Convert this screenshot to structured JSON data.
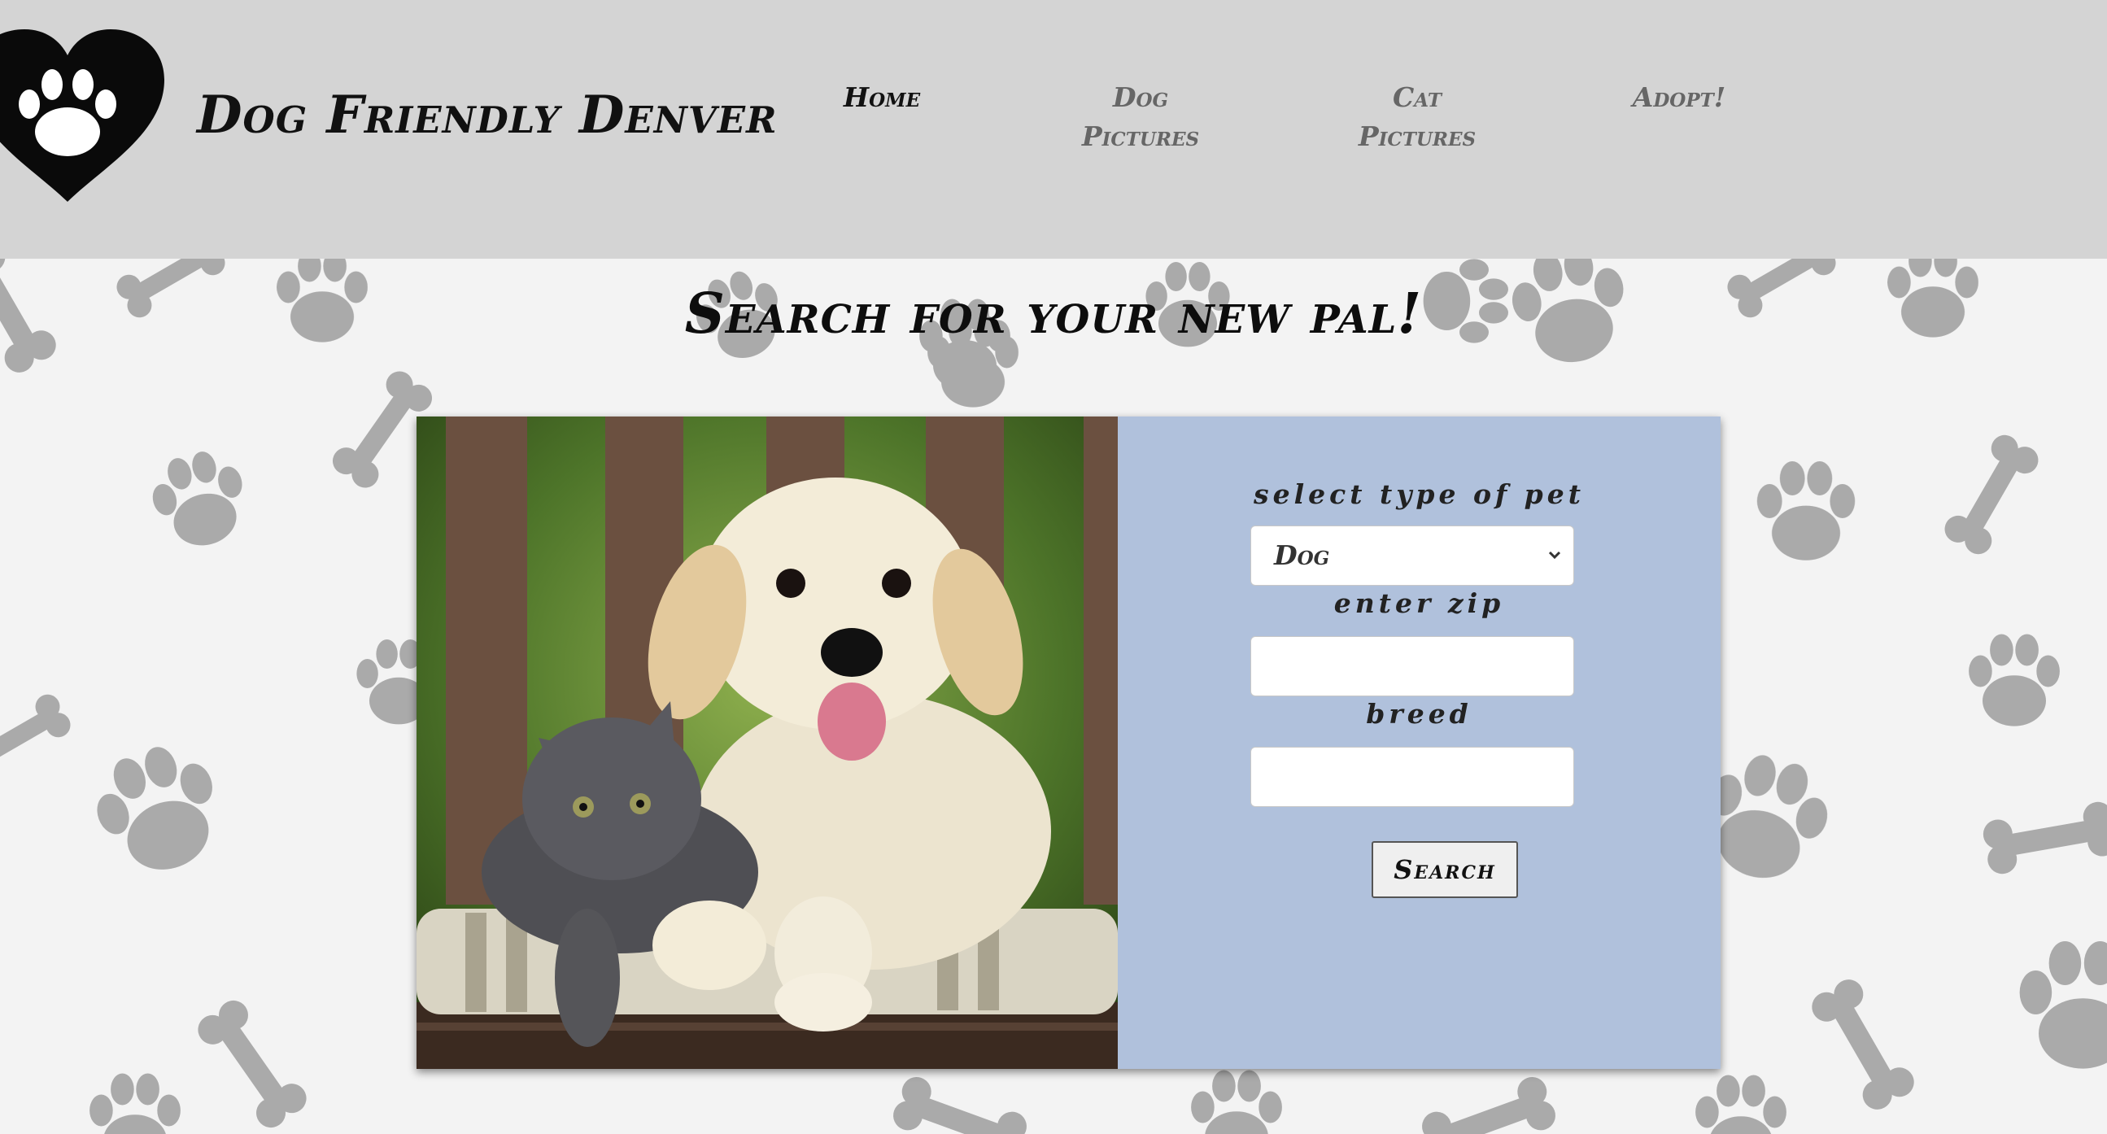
{
  "header": {
    "site_title": "Dog Friendly Denver",
    "nav": [
      {
        "line1": "Home",
        "line2": ""
      },
      {
        "line1": "Dog",
        "line2": "Pictures"
      },
      {
        "line1": "Cat",
        "line2": "Pictures"
      },
      {
        "line1": "Adopt!",
        "line2": ""
      }
    ]
  },
  "main": {
    "heading": "Search for your new pal!"
  },
  "form": {
    "pet_type_label": "select type of pet",
    "pet_type_value": "Dog",
    "zip_label": "enter zip",
    "zip_value": "",
    "breed_label": "breed",
    "breed_value": "",
    "search_label": "Search"
  },
  "icons": {
    "logo": "heart-paw-icon",
    "select_arrow": "chevron-down-icon"
  },
  "colors": {
    "header_bg": "#d4d4d4",
    "form_panel_bg": "#b0c1dc",
    "pattern": "#9e9e9e"
  }
}
